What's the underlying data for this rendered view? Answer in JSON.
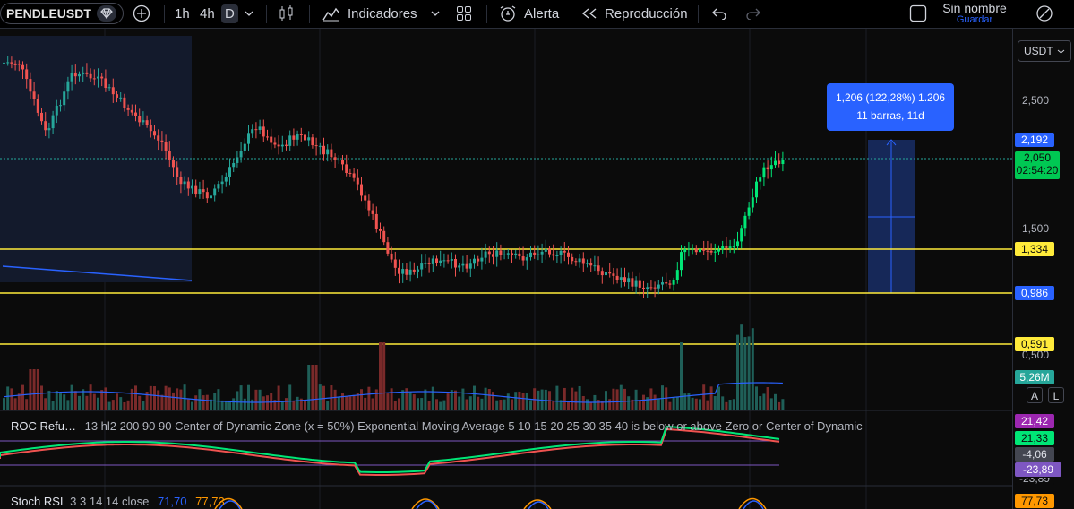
{
  "toolbar": {
    "symbol": "PENDLEUSDT",
    "timeframes": [
      "1h",
      "4h",
      "D"
    ],
    "active_timeframe": "D",
    "indicators_label": "Indicadores",
    "alert_label": "Alerta",
    "replay_label": "Reproducción",
    "layout_name": "Sin nombre",
    "save_label": "Guardar"
  },
  "price_axis": {
    "currency": "USDT",
    "labels": [
      "2,500",
      "1,500",
      "0,500"
    ],
    "badges": {
      "measure_top": "2,192",
      "last_price": "2,050",
      "countdown": "02:54:20",
      "level_1": "1,334",
      "measure_bottom": "0,986",
      "level_2": "0,591",
      "volume": "5,26M",
      "roc_1": "21,42",
      "roc_2": "21,33",
      "roc_3": "-4,06",
      "roc_4": "-23,89",
      "roc_5": "-23,89",
      "stoch": "77,73"
    },
    "auto_label": "A",
    "log_label": "L"
  },
  "measure": {
    "line1": "1,206 (122,28%) 1.206",
    "line2": "11 barras, 11d"
  },
  "roc": {
    "name": "ROC Refu…",
    "params": "13 hl2 200 90 90 Center of Dynamic Zone (x = 50%) Exponential Moving Average 5 10 15 20 25 30 35 40 is below or above Zero or Center of Dynamic"
  },
  "stoch": {
    "name": "Stoch RSI",
    "params": "3 3 14 14 close",
    "k": "71,70",
    "d": "77,73"
  },
  "colors": {
    "up": "#26a69a",
    "up_bright": "#00e676",
    "down": "#ef5350",
    "level": "#ffeb3b",
    "measure": "#2962ff",
    "volume_ma": "#2962ff"
  }
}
